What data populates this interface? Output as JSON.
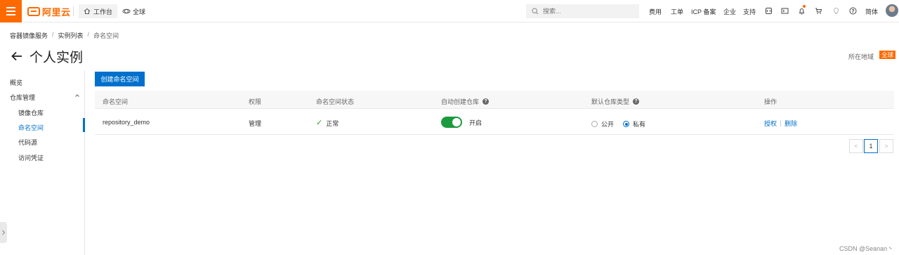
{
  "topbar": {
    "logo_text": "阿里云",
    "workbench_label": "工作台",
    "region_label": "全球",
    "search_placeholder": "搜索...",
    "links": [
      "费用",
      "工单",
      "ICP 备案",
      "企业",
      "支持"
    ],
    "lang_label": "简体"
  },
  "breadcrumb": {
    "items": [
      "容器镜像服务",
      "实例列表",
      "命名空间"
    ],
    "separator": "/"
  },
  "header": {
    "title": "个人实例",
    "region_label": "所在地域",
    "region_value": "全球"
  },
  "sidebar": {
    "items": [
      {
        "label": "概览"
      },
      {
        "label": "仓库管理"
      },
      {
        "label": "镜像仓库"
      },
      {
        "label": "命名空间"
      },
      {
        "label": "代码源"
      },
      {
        "label": "访问凭证"
      }
    ]
  },
  "main": {
    "create_button_label": "创建命名空间",
    "table": {
      "columns": [
        "命名空间",
        "权限",
        "命名空间状态",
        "自动创建仓库",
        "默认仓库类型",
        "操作"
      ],
      "rows": [
        {
          "namespace": "repository_demo",
          "permission": "管理",
          "status": "正常",
          "auto_create": "开启",
          "auto_create_on": true,
          "repo_type_options": [
            "公开",
            "私有"
          ],
          "repo_type_selected": "私有",
          "actions": [
            "授权",
            "删除"
          ]
        }
      ]
    },
    "pagination": {
      "prev": "<",
      "current_page": "1",
      "next": ">"
    }
  },
  "watermark": "CSDN @Seanan丶",
  "colors": {
    "brand_orange": "#ff6a00",
    "primary_blue": "#0070cc",
    "success_green": "#2ea121",
    "toggle_green": "#1b9a3e"
  }
}
